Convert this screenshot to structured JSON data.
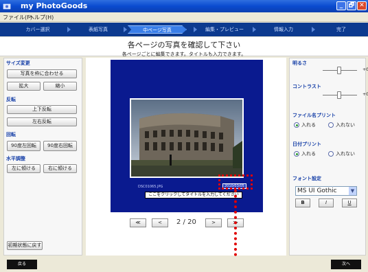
{
  "window": {
    "title": "my PhotoGoods",
    "min": "_",
    "max": "🗗",
    "close": "✕"
  },
  "menu": [
    "ファイル(F)",
    "ヘルプ(H)"
  ],
  "steps": [
    {
      "label": "カバー選択",
      "active": false
    },
    {
      "label": "表紙写真",
      "active": false
    },
    {
      "label": "中ページ写真",
      "active": true
    },
    {
      "label": "編集・プレビュー",
      "active": false
    },
    {
      "label": "情報入力",
      "active": false
    },
    {
      "label": "完了",
      "active": false
    }
  ],
  "heading": {
    "title": "各ページの写真を確認して下さい",
    "subtitle": "各ページごとに編集できます。タイトルも入力できます。"
  },
  "left": {
    "size_section": "サイズ変更",
    "fit_frame": "写真を枠に合わせる",
    "zoom_in": "拡大",
    "zoom_out": "縮小",
    "flip_section": "反転",
    "flip_vertical": "上下反転",
    "flip_horizontal": "左右反転",
    "rotate_section": "回転",
    "rotate_left": "90度左回転",
    "rotate_right": "90度右回転",
    "level_section": "水平調整",
    "tilt_left": "左に傾ける",
    "tilt_right": "右に傾ける",
    "reset": "初期状態に戻す"
  },
  "canvas": {
    "filename": "DSC01065.JPG",
    "date_stamp": "2010/03/05",
    "caption": "ここをクリックしてタイトルを入力してください"
  },
  "pager": {
    "first": "≪",
    "prev": "<",
    "indicator": "2 / 20",
    "next": ">",
    "last": "≫"
  },
  "right": {
    "brightness_label": "明るさ",
    "brightness_value": "+0",
    "contrast_label": "コントラスト",
    "contrast_value": "+0",
    "filename_label": "ファイル名プリント",
    "filename_on": "入れる",
    "filename_off": "入れない",
    "date_label": "日付プリント",
    "date_on": "入れる",
    "date_off": "入れない",
    "font_label": "フォント設定",
    "font_value": "MS UI Gothic",
    "bold": "B",
    "italic": "I",
    "underline": "U"
  },
  "footer": {
    "back": "戻る",
    "next": "次へ"
  },
  "colors": {
    "step_bar": "#0c3a8f",
    "page_bg": "#0a1a8f",
    "highlight": "#e00000"
  }
}
